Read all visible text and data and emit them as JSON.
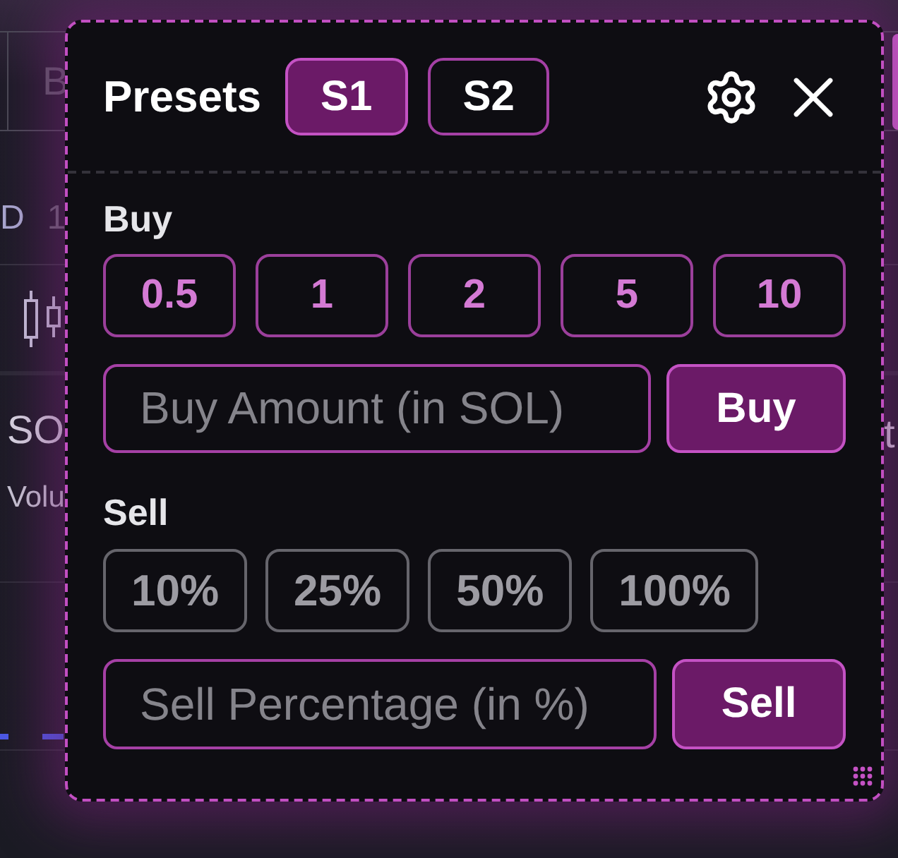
{
  "background_page": {
    "toolbar_field": {
      "placeholder": "B"
    },
    "balance": {
      "label": "D",
      "value": "1"
    },
    "chart_header": {
      "pair_title": "SO",
      "indicator": "Volu"
    },
    "right_edge": {
      "pair_title": "t"
    }
  },
  "presets_panel": {
    "title": "Presets",
    "tabs": [
      {
        "label": "S1",
        "selected": true
      },
      {
        "label": "S2",
        "selected": false
      }
    ],
    "buy": {
      "label": "Buy",
      "presets": [
        "0.5",
        "1",
        "2",
        "5",
        "10"
      ],
      "amount_field": {
        "placeholder": "Buy Amount (in SOL)"
      },
      "button": "Buy"
    },
    "sell": {
      "label": "Sell",
      "presets": [
        "10%",
        "25%",
        "50%",
        "100%"
      ],
      "percentage_field": {
        "placeholder": "Sell Percentage (in %)"
      },
      "button": "Sell"
    }
  }
}
